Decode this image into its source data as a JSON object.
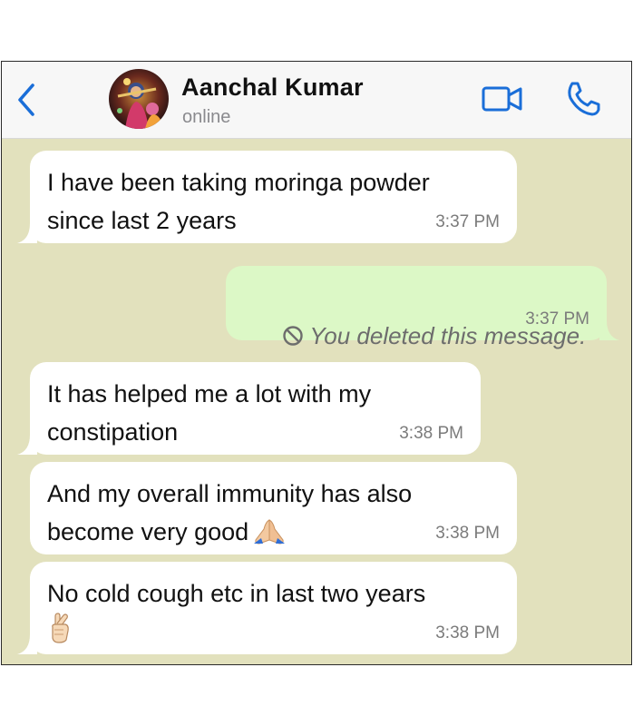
{
  "header": {
    "contact_name": "Aanchal Kumar",
    "status": "online",
    "back_icon": "chevron-left-icon",
    "video_icon": "video-camera-icon",
    "call_icon": "phone-icon",
    "accent_color": "#1a6ed8"
  },
  "chat": {
    "background_color": "#e2e1bd",
    "incoming_bubble_color": "#ffffff",
    "outgoing_bubble_color": "#dcf8c6",
    "messages": [
      {
        "direction": "incoming",
        "text": "I have been taking moringa powder\nsince last 2 years",
        "time": "3:37 PM"
      },
      {
        "direction": "outgoing",
        "deleted": true,
        "text": "You deleted this message.",
        "time": "3:37 PM"
      },
      {
        "direction": "incoming",
        "text": "It has helped me a lot with my\nconstipation",
        "time": "3:38 PM"
      },
      {
        "direction": "incoming",
        "text": "And my overall immunity has also\nbecome very good",
        "emoji": "folded-hands-emoji",
        "time": "3:38 PM"
      },
      {
        "direction": "incoming",
        "text": "No cold cough etc in last two years",
        "emoji": "crossed-fingers-emoji",
        "time": "3:38 PM"
      }
    ]
  }
}
